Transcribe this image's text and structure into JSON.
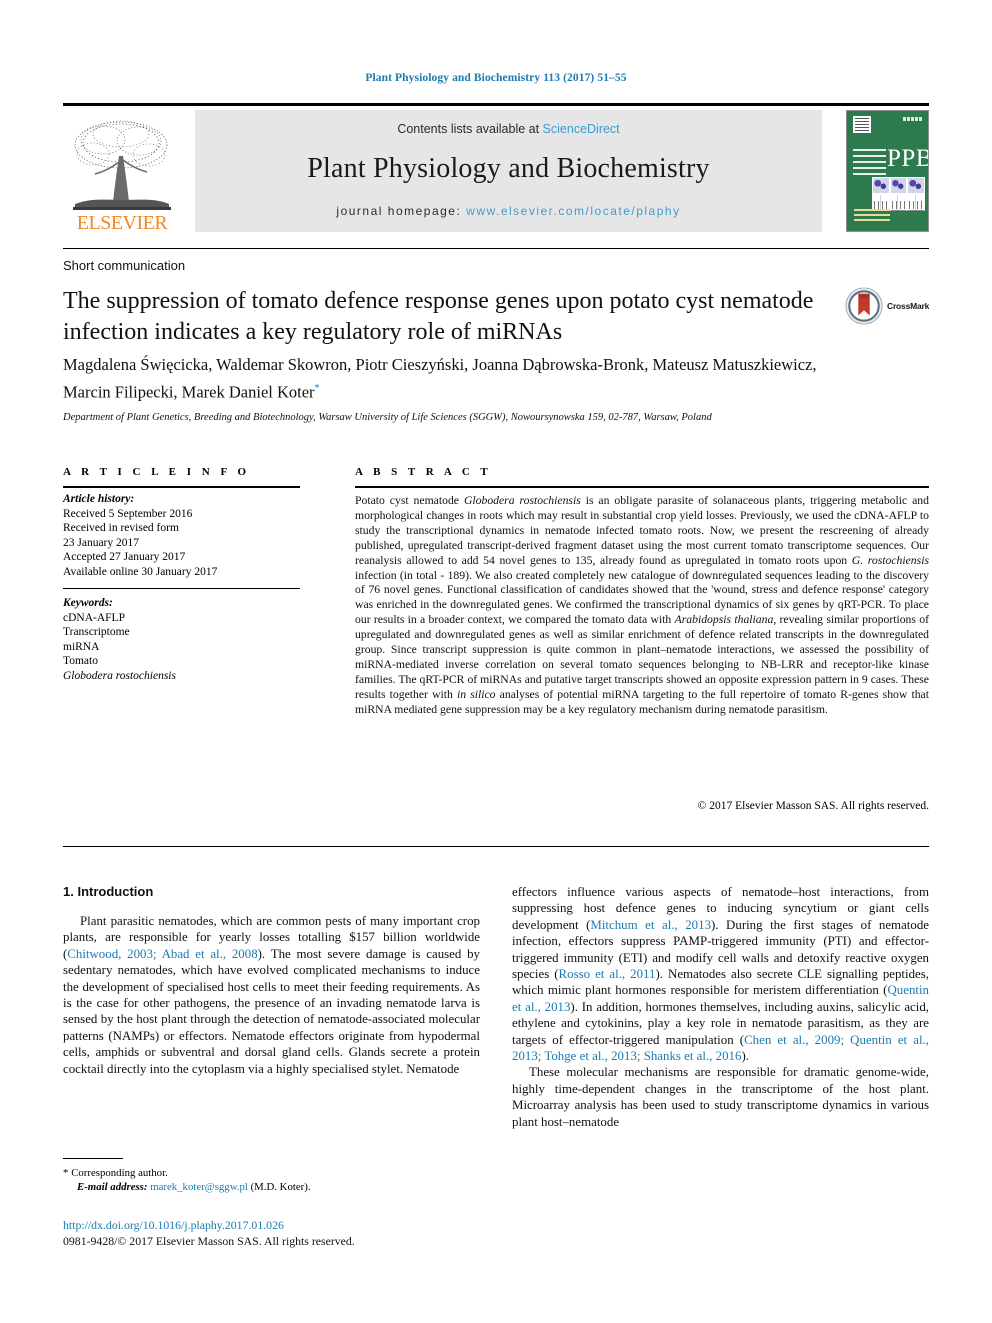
{
  "running_head": "Plant Physiology and Biochemistry 113 (2017) 51–55",
  "masthead": {
    "contents_prefix": "Contents lists available at ",
    "sciencedirect": "ScienceDirect",
    "journal_name": "Plant Physiology and Biochemistry",
    "homepage_label": "journal homepage: ",
    "homepage_url": "www.elsevier.com/locate/plaphy",
    "publisher_logo_text": "ELSEVIER",
    "cover_title": "PPB",
    "link_color": "#3d9bd0",
    "box_color": "#e6e6e6",
    "cover_color": "#2d7a4f"
  },
  "article": {
    "type": "Short communication",
    "title": "The suppression of tomato defence response genes upon potato cyst nematode infection indicates a key regulatory role of miRNAs",
    "authors": "Magdalena Święcicka, Waldemar Skowron, Piotr Cieszyński, Joanna Dąbrowska-Bronk, Mateusz Matuszkiewicz, Marcin Filipecki, Marek Daniel Koter",
    "author_superscript": "*",
    "affiliation": "Department of Plant Genetics, Breeding and Biotechnology, Warsaw University of Life Sciences (SGGW), Nowoursynowska 159, 02-787, Warsaw, Poland",
    "crossmark_label": "CrossMark"
  },
  "article_info": {
    "heading": "A R T I C L E   I N F O",
    "history_label": "Article history:",
    "history": [
      "Received 5 September 2016",
      "Received in revised form",
      "23 January 2017",
      "Accepted 27 January 2017",
      "Available online 30 January 2017"
    ],
    "keywords_label": "Keywords:",
    "keywords": [
      "cDNA-AFLP",
      "Transcriptome",
      "miRNA",
      "Tomato",
      "Globodera rostochiensis"
    ]
  },
  "abstract": {
    "heading": "A B S T R A C T",
    "text_part1": "Potato cyst nematode ",
    "species1": "Globodera rostochiensis",
    "text_part2": " is an obligate parasite of solanaceous plants, triggering metabolic and morphological changes in roots which may result in substantial crop yield losses. Previously, we used the cDNA-AFLP to study the transcriptional dynamics in nematode infected tomato roots. Now, we present the rescreening of already published, upregulated transcript-derived fragment dataset using the most current tomato transcriptome sequences. Our reanalysis allowed to add 54 novel genes to 135, already found as upregulated in tomato roots upon ",
    "species2": "G. rostochiensis",
    "text_part3": " infection (in total - 189). We also created completely new catalogue of downregulated sequences leading to the discovery of 76 novel genes. Functional classification of candidates showed that the 'wound, stress and defence response' category was enriched in the downregulated genes. We confirmed the transcriptional dynamics of six genes by qRT-PCR. To place our results in a broader context, we compared the tomato data with ",
    "species3": "Arabidopsis thaliana",
    "text_part4": ", revealing similar proportions of upregulated and downregulated genes as well as similar enrichment of defence related transcripts in the downregulated group. Since transcript suppression is quite common in plant–nematode interactions, we assessed the possibility of miRNA-mediated inverse correlation on several tomato sequences belonging to NB-LRR and receptor-like kinase families. The qRT-PCR of miRNAs and putative target transcripts showed an opposite expression pattern in 9 cases. These results together with ",
    "species4": "in silico",
    "text_part5": " analyses of potential miRNA targeting to the full repertoire of tomato R-genes show that miRNA mediated gene suppression may be a key regulatory mechanism during nematode parasitism.",
    "copyright": "© 2017 Elsevier Masson SAS. All rights reserved."
  },
  "body": {
    "section_number_title": "1.  Introduction",
    "left_paragraph_1_a": "Plant parasitic nematodes, which are common pests of many important crop plants, are responsible for yearly losses totalling $157 billion worldwide (",
    "left_cite_1": "Chitwood, 2003; Abad et al., 2008",
    "left_paragraph_1_b": "). The most severe damage is caused by sedentary nematodes, which have evolved complicated mechanisms to induce the development of specialised host cells to meet their feeding requirements. As is the case for other pathogens, the presence of an invading nematode larva is sensed by the host plant through the detection of nematode-associated molecular patterns (NAMPs) or effectors. Nematode effectors originate from hypodermal cells, amphids or subventral and dorsal gland cells. Glands secrete a protein cocktail directly into the cytoplasm via a highly specialised stylet. Nematode",
    "right_paragraph_1_a": "effectors influence various aspects of nematode–host interactions, from suppressing host defence genes to inducing syncytium or giant cells development (",
    "right_cite_1": "Mitchum et al., 2013",
    "right_paragraph_1_b": "). During the first stages of nematode infection, effectors suppress PAMP-triggered immunity (PTI) and effector-triggered immunity (ETI) and modify cell walls and detoxify reactive oxygen species (",
    "right_cite_2": "Rosso et al., 2011",
    "right_paragraph_1_c": "). Nematodes also secrete CLE signalling peptides, which mimic plant hormones responsible for meristem differentiation (",
    "right_cite_3": "Quentin et al., 2013",
    "right_paragraph_1_d": "). In addition, hormones themselves, including auxins, salicylic acid, ethylene and cytokinins, play a key role in nematode parasitism, as they are targets of effector-triggered manipulation (",
    "right_cite_4": "Chen et al., 2009; Quentin et al., 2013; Tohge et al., 2013; Shanks et al., 2016",
    "right_paragraph_1_e": ").",
    "right_paragraph_2": "These molecular mechanisms are responsible for dramatic genome-wide, highly time-dependent changes in the transcriptome of the host plant. Microarray analysis has been used to study transcriptome dynamics in various plant host–nematode"
  },
  "footer": {
    "corresponding_label": "Corresponding author.",
    "email_label": "E-mail address:",
    "email": "marek_koter@sggw.pl",
    "email_suffix": " (M.D. Koter).",
    "doi": "http://dx.doi.org/10.1016/j.plaphy.2017.01.026",
    "issn_line": "0981-9428/© 2017 Elsevier Masson SAS. All rights reserved."
  }
}
